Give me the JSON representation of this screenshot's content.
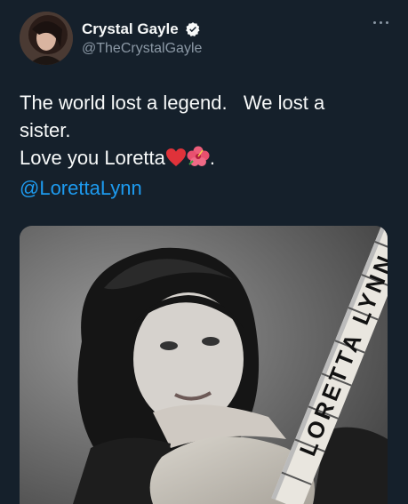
{
  "author": {
    "display_name": "Crystal Gayle",
    "handle": "@TheCrystalGayle",
    "verified": true,
    "avatar": "profile-photo"
  },
  "tweet": {
    "line1": "The world lost a legend.   We lost a",
    "line2": "sister.",
    "line3": "Love you Loretta",
    "line3_suffix": ".",
    "mention": "@LorettaLynn",
    "emojis": [
      "red-heart-emoji",
      "hibiscus-emoji"
    ]
  },
  "media": {
    "description_icon": "photo",
    "guitar_text": "LORETTA LYNN"
  },
  "colors": {
    "background": "#15202b",
    "text": "#f7f9f9",
    "secondary": "#8b98a5",
    "link": "#1d9bf0",
    "verified": "#f7f9f9"
  }
}
